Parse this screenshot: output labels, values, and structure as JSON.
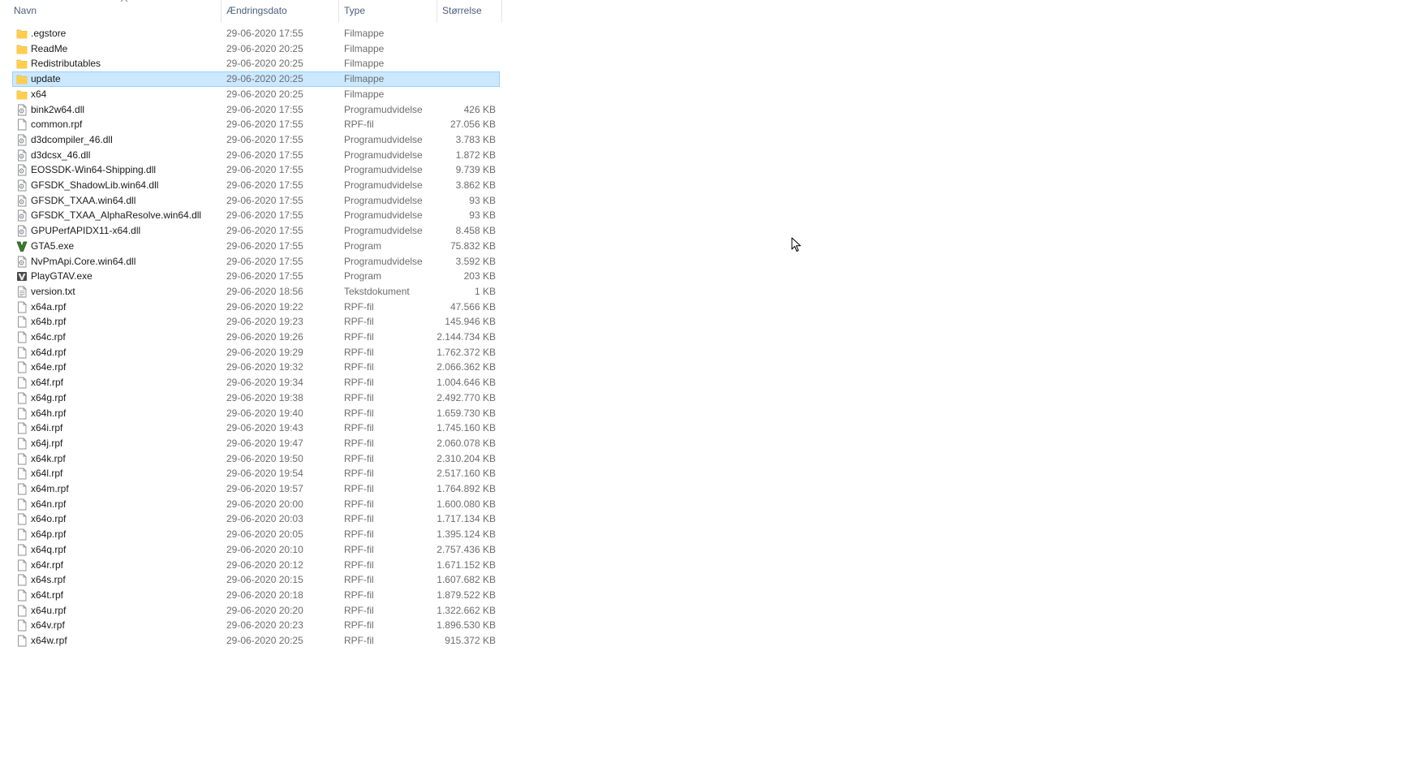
{
  "columns": {
    "name": "Navn",
    "date": "Ændringsdato",
    "type": "Type",
    "size": "Størrelse"
  },
  "files": [
    {
      "name": ".egstore",
      "date": "29-06-2020 17:55",
      "type": "Filmappe",
      "size": "",
      "icon": "folder-icon"
    },
    {
      "name": "ReadMe",
      "date": "29-06-2020 20:25",
      "type": "Filmappe",
      "size": "",
      "icon": "folder-icon"
    },
    {
      "name": "Redistributables",
      "date": "29-06-2020 20:25",
      "type": "Filmappe",
      "size": "",
      "icon": "folder-icon"
    },
    {
      "name": "update",
      "date": "29-06-2020 20:25",
      "type": "Filmappe",
      "size": "",
      "icon": "folder-icon",
      "selected": true
    },
    {
      "name": "x64",
      "date": "29-06-2020 20:25",
      "type": "Filmappe",
      "size": "",
      "icon": "folder-icon"
    },
    {
      "name": "bink2w64.dll",
      "date": "29-06-2020 17:55",
      "type": "Programudvidelse",
      "size": "426 KB",
      "icon": "dll-icon"
    },
    {
      "name": "common.rpf",
      "date": "29-06-2020 17:55",
      "type": "RPF-fil",
      "size": "27.056 KB",
      "icon": "file-icon"
    },
    {
      "name": "d3dcompiler_46.dll",
      "date": "29-06-2020 17:55",
      "type": "Programudvidelse",
      "size": "3.783 KB",
      "icon": "dll-icon"
    },
    {
      "name": "d3dcsx_46.dll",
      "date": "29-06-2020 17:55",
      "type": "Programudvidelse",
      "size": "1.872 KB",
      "icon": "dll-icon"
    },
    {
      "name": "EOSSDK-Win64-Shipping.dll",
      "date": "29-06-2020 17:55",
      "type": "Programudvidelse",
      "size": "9.739 KB",
      "icon": "dll-icon"
    },
    {
      "name": "GFSDK_ShadowLib.win64.dll",
      "date": "29-06-2020 17:55",
      "type": "Programudvidelse",
      "size": "3.862 KB",
      "icon": "dll-icon"
    },
    {
      "name": "GFSDK_TXAA.win64.dll",
      "date": "29-06-2020 17:55",
      "type": "Programudvidelse",
      "size": "93 KB",
      "icon": "dll-icon"
    },
    {
      "name": "GFSDK_TXAA_AlphaResolve.win64.dll",
      "date": "29-06-2020 17:55",
      "type": "Programudvidelse",
      "size": "93 KB",
      "icon": "dll-icon"
    },
    {
      "name": "GPUPerfAPIDX11-x64.dll",
      "date": "29-06-2020 17:55",
      "type": "Programudvidelse",
      "size": "8.458 KB",
      "icon": "dll-icon"
    },
    {
      "name": "GTA5.exe",
      "date": "29-06-2020 17:55",
      "type": "Program",
      "size": "75.832 KB",
      "icon": "gta-v-icon"
    },
    {
      "name": "NvPmApi.Core.win64.dll",
      "date": "29-06-2020 17:55",
      "type": "Programudvidelse",
      "size": "3.592 KB",
      "icon": "dll-icon"
    },
    {
      "name": "PlayGTAV.exe",
      "date": "29-06-2020 17:55",
      "type": "Program",
      "size": "203 KB",
      "icon": "playgtav-icon"
    },
    {
      "name": "version.txt",
      "date": "29-06-2020 18:56",
      "type": "Tekstdokument",
      "size": "1 KB",
      "icon": "text-file-icon"
    },
    {
      "name": "x64a.rpf",
      "date": "29-06-2020 19:22",
      "type": "RPF-fil",
      "size": "47.566 KB",
      "icon": "file-icon"
    },
    {
      "name": "x64b.rpf",
      "date": "29-06-2020 19:23",
      "type": "RPF-fil",
      "size": "145.946 KB",
      "icon": "file-icon"
    },
    {
      "name": "x64c.rpf",
      "date": "29-06-2020 19:26",
      "type": "RPF-fil",
      "size": "2.144.734 KB",
      "icon": "file-icon"
    },
    {
      "name": "x64d.rpf",
      "date": "29-06-2020 19:29",
      "type": "RPF-fil",
      "size": "1.762.372 KB",
      "icon": "file-icon"
    },
    {
      "name": "x64e.rpf",
      "date": "29-06-2020 19:32",
      "type": "RPF-fil",
      "size": "2.066.362 KB",
      "icon": "file-icon"
    },
    {
      "name": "x64f.rpf",
      "date": "29-06-2020 19:34",
      "type": "RPF-fil",
      "size": "1.004.646 KB",
      "icon": "file-icon"
    },
    {
      "name": "x64g.rpf",
      "date": "29-06-2020 19:38",
      "type": "RPF-fil",
      "size": "2.492.770 KB",
      "icon": "file-icon"
    },
    {
      "name": "x64h.rpf",
      "date": "29-06-2020 19:40",
      "type": "RPF-fil",
      "size": "1.659.730 KB",
      "icon": "file-icon"
    },
    {
      "name": "x64i.rpf",
      "date": "29-06-2020 19:43",
      "type": "RPF-fil",
      "size": "1.745.160 KB",
      "icon": "file-icon"
    },
    {
      "name": "x64j.rpf",
      "date": "29-06-2020 19:47",
      "type": "RPF-fil",
      "size": "2.060.078 KB",
      "icon": "file-icon"
    },
    {
      "name": "x64k.rpf",
      "date": "29-06-2020 19:50",
      "type": "RPF-fil",
      "size": "2.310.204 KB",
      "icon": "file-icon"
    },
    {
      "name": "x64l.rpf",
      "date": "29-06-2020 19:54",
      "type": "RPF-fil",
      "size": "2.517.160 KB",
      "icon": "file-icon"
    },
    {
      "name": "x64m.rpf",
      "date": "29-06-2020 19:57",
      "type": "RPF-fil",
      "size": "1.764.892 KB",
      "icon": "file-icon"
    },
    {
      "name": "x64n.rpf",
      "date": "29-06-2020 20:00",
      "type": "RPF-fil",
      "size": "1.600.080 KB",
      "icon": "file-icon"
    },
    {
      "name": "x64o.rpf",
      "date": "29-06-2020 20:03",
      "type": "RPF-fil",
      "size": "1.717.134 KB",
      "icon": "file-icon"
    },
    {
      "name": "x64p.rpf",
      "date": "29-06-2020 20:05",
      "type": "RPF-fil",
      "size": "1.395.124 KB",
      "icon": "file-icon"
    },
    {
      "name": "x64q.rpf",
      "date": "29-06-2020 20:10",
      "type": "RPF-fil",
      "size": "2.757.436 KB",
      "icon": "file-icon"
    },
    {
      "name": "x64r.rpf",
      "date": "29-06-2020 20:12",
      "type": "RPF-fil",
      "size": "1.671.152 KB",
      "icon": "file-icon"
    },
    {
      "name": "x64s.rpf",
      "date": "29-06-2020 20:15",
      "type": "RPF-fil",
      "size": "1.607.682 KB",
      "icon": "file-icon"
    },
    {
      "name": "x64t.rpf",
      "date": "29-06-2020 20:18",
      "type": "RPF-fil",
      "size": "1.879.522 KB",
      "icon": "file-icon"
    },
    {
      "name": "x64u.rpf",
      "date": "29-06-2020 20:20",
      "type": "RPF-fil",
      "size": "1.322.662 KB",
      "icon": "file-icon"
    },
    {
      "name": "x64v.rpf",
      "date": "29-06-2020 20:23",
      "type": "RPF-fil",
      "size": "1.896.530 KB",
      "icon": "file-icon"
    },
    {
      "name": "x64w.rpf",
      "date": "29-06-2020 20:25",
      "type": "RPF-fil",
      "size": "915.372 KB",
      "icon": "file-icon"
    }
  ],
  "colors": {
    "folder": "#ffd766",
    "selection_bg": "#cce8ff",
    "selection_border": "#99d1ff",
    "header_text": "#4c607a",
    "gta_green": "#3a7d2c"
  }
}
